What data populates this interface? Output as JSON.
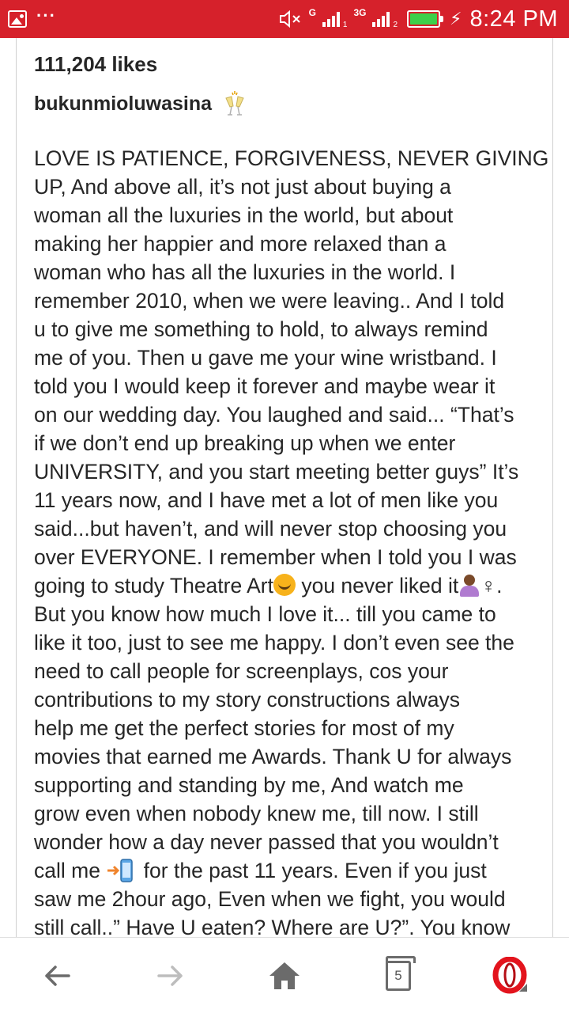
{
  "status_bar": {
    "network_type": "G",
    "network_type_2": "3G",
    "sim1_label": "1",
    "sim2_label": "2",
    "time": "8:24 PM",
    "battery_level": 1.0,
    "colors": {
      "background": "#d6212b",
      "battery_fill": "#3cd04a"
    }
  },
  "post": {
    "likes": "111,204 likes",
    "username": "bukunmioluwasina",
    "username_emoji": "clinking-glasses-icon",
    "caption_lines": [
      "LOVE IS PATIENCE, FORGIVENESS, NEVER GIVING",
      "UP, And above all, it’s not just about buying a",
      "woman all the luxuries in the world, but about",
      "making her happier and more relaxed than a",
      "woman who has all the luxuries in the world. I",
      "remember 2010, when we were leaving.. And I told",
      "u to give me something to hold, to always remind",
      "me of you. Then u gave me your wine wristband. I",
      "told you I would keep it forever and maybe wear it",
      "on our wedding day. You laughed and said... “That’s",
      "if we don’t end up breaking up when we enter",
      "UNIVERSITY, and you start meeting better guys” It’s",
      "11 years now, and I have met a lot of men like you",
      "said...but haven’t, and will never stop choosing you",
      "over EVERYONE. I remember when I told you I was"
    ],
    "line16_a": "going to study Theatre Art",
    "line16_b": " you never liked it",
    "line16_c": "♀.",
    "caption_lines_2": [
      "But you know how much I love it... till you came to",
      "like it too, just to see me happy. I don’t even see the",
      "need to call people for screenplays, cos your",
      "contributions to my story constructions always",
      "help me get the perfect stories for most of my",
      "movies that earned me Awards. Thank U for always",
      "supporting and standing by me, And watch me",
      "grow even when nobody knew me, till now. I still",
      "wonder how a day never passed that you wouldn’t"
    ],
    "line26_a": "call me ",
    "line26_b": " for the past 11 years. Even if you just",
    "caption_lines_3": [
      "saw me 2hour ago, Even when we fight, you would",
      "still call..” Have U eaten? Where are U?”. You know"
    ]
  },
  "bottom_nav": {
    "tab_count": "5",
    "colors": {
      "icon": "#6b6b6b",
      "opera": "#e3141d"
    }
  }
}
